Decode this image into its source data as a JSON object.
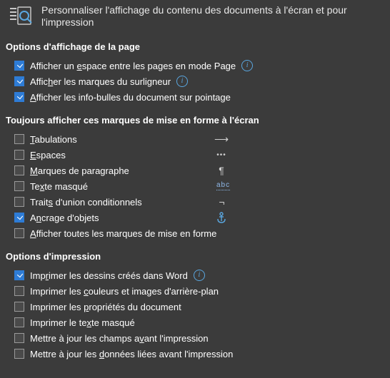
{
  "header": {
    "title": "Personnaliser l'affichage du contenu des documents à l'écran et pour l'impression"
  },
  "sections": {
    "page_display": {
      "title": "Options d'affichage de la page",
      "items": [
        {
          "checked": true,
          "pre": "Afficher un ",
          "mn": "e",
          "post": "space entre les pages en mode Page",
          "info": true
        },
        {
          "checked": true,
          "pre": "Affic",
          "mn": "h",
          "post": "er les marques du surligneur",
          "info": true
        },
        {
          "checked": true,
          "pre": "",
          "mn": "A",
          "post": "fficher les info-bulles du document sur pointage",
          "info": false
        }
      ]
    },
    "formatting": {
      "title": "Toujours afficher ces marques de mise en forme à l'écran",
      "items": [
        {
          "checked": false,
          "pre": "",
          "mn": "T",
          "post": "abulations",
          "glyph": "arrow"
        },
        {
          "checked": false,
          "pre": "",
          "mn": "E",
          "post": "spaces",
          "glyph": "dots"
        },
        {
          "checked": false,
          "pre": "",
          "mn": "M",
          "post": "arques de paragraphe",
          "glyph": "pilcrow"
        },
        {
          "checked": false,
          "pre": "Te",
          "mn": "x",
          "post": "te masqué",
          "glyph": "abc"
        },
        {
          "checked": false,
          "pre": "Trait",
          "mn": "s",
          "post": " d'union conditionnels",
          "glyph": "hyphen"
        },
        {
          "checked": true,
          "pre": "A",
          "mn": "n",
          "post": "crage d'objets",
          "glyph": "anchor"
        },
        {
          "checked": false,
          "pre": "",
          "mn": "A",
          "post": "fficher toutes les marques de mise en forme",
          "glyph": ""
        }
      ]
    },
    "printing": {
      "title": "Options d'impression",
      "items": [
        {
          "checked": true,
          "pre": "Imp",
          "mn": "r",
          "post": "imer les dessins créés dans Word",
          "info": true
        },
        {
          "checked": false,
          "pre": "Imprimer les ",
          "mn": "c",
          "post": "ouleurs et images d'arrière-plan",
          "info": false
        },
        {
          "checked": false,
          "pre": "Imprimer les ",
          "mn": "p",
          "post": "ropriétés du document",
          "info": false
        },
        {
          "checked": false,
          "pre": "Imprimer le te",
          "mn": "x",
          "post": "te masqué",
          "info": false
        },
        {
          "checked": false,
          "pre": "Mettre à jour les champs a",
          "mn": "v",
          "post": "ant l'impression",
          "info": false
        },
        {
          "checked": false,
          "pre": "Mettre à jour les ",
          "mn": "d",
          "post": "onnées liées avant l'impression",
          "info": false
        }
      ]
    }
  }
}
